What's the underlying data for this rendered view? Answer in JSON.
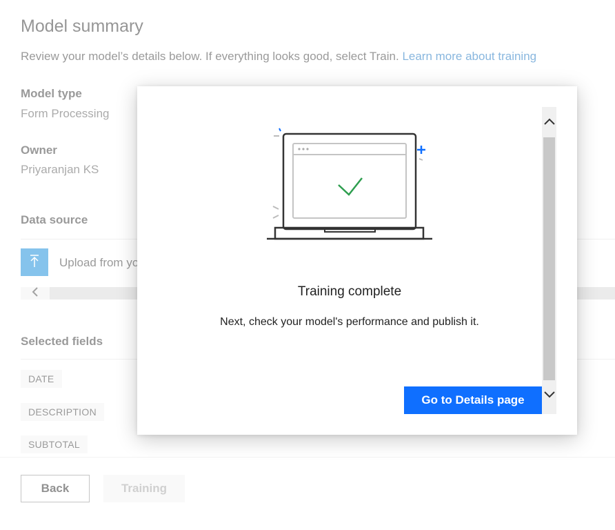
{
  "page": {
    "title": "Model summary",
    "intro_text": "Review your model’s details below. If everything looks good, select Train.",
    "learn_more_link": "Learn more about training"
  },
  "model_type": {
    "label": "Model type",
    "value": "Form Processing"
  },
  "owner": {
    "label": "Owner",
    "value": "Priyaranjan KS"
  },
  "data_source": {
    "label": "Data source",
    "upload_text": "Upload from yo"
  },
  "selected_fields": {
    "label": "Selected fields",
    "tags": [
      "DATE",
      "DESCRIPTION",
      "SUBTOTAL"
    ]
  },
  "footer": {
    "back_label": "Back",
    "training_label": "Training"
  },
  "dialog": {
    "title": "Training complete",
    "message": "Next, check your model's performance and publish it.",
    "primary_button": "Go to Details page"
  },
  "colors": {
    "accent": "#0f6fff",
    "link": "#0f6cbd",
    "success": "#2e9e4f"
  },
  "icons": [
    "upload-icon",
    "chevron-left-icon",
    "laptop-check-icon",
    "chevron-up-icon",
    "chevron-down-icon"
  ]
}
